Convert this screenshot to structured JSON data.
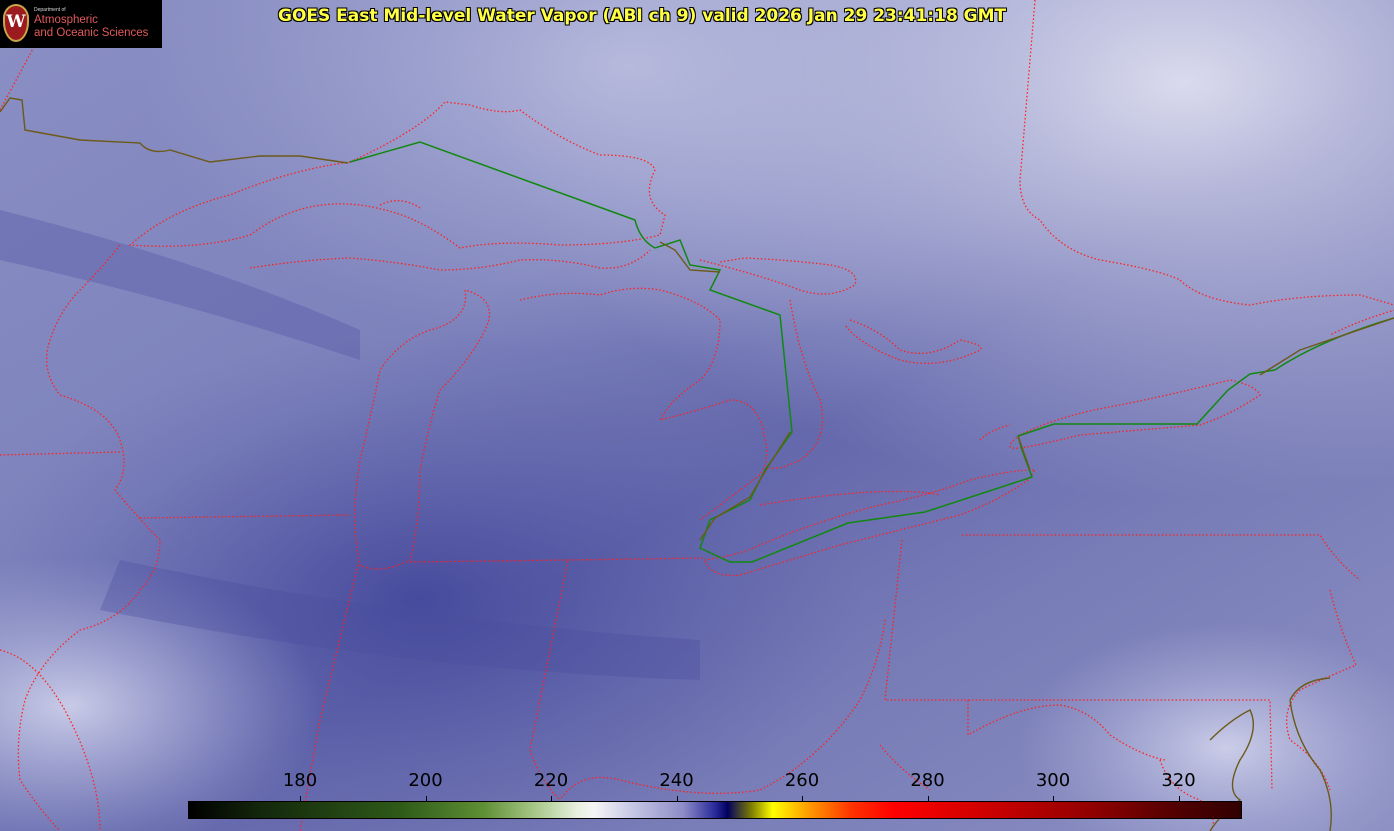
{
  "header": {
    "title": "GOES East Mid-level Water Vapor (ABI ch 9)  valid 2026 Jan 29 23:41:18 GMT"
  },
  "logo": {
    "seal_letter": "W",
    "dept_text": "Department of",
    "line1": "Atmospheric",
    "line2": "and Oceanic Sciences"
  },
  "colorbar": {
    "ticks": [
      "180",
      "200",
      "220",
      "240",
      "260",
      "280",
      "300",
      "320"
    ]
  },
  "colors": {
    "background_vapor": "#7a7fb6",
    "boundary_red": "#ff2020",
    "border_green": "#118811",
    "coast_olive": "#6b5a1a",
    "title_yellow": "#ffff44"
  }
}
